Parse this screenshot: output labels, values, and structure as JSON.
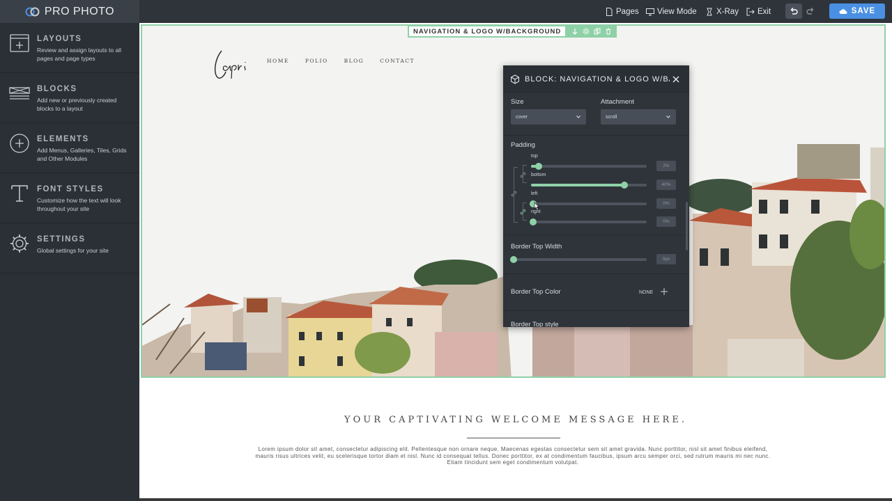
{
  "brand": {
    "name": "PRO PHOTO"
  },
  "topbar": {
    "pages": "Pages",
    "view_mode": "View Mode",
    "xray": "X-Ray",
    "exit": "Exit",
    "save": "SAVE",
    "accent": "#4a90e2"
  },
  "sidebar": {
    "items": [
      {
        "title": "LAYOUTS",
        "desc": "Review and assign layouts to all pages and page types",
        "icon": "layout-icon"
      },
      {
        "title": "BLOCKS",
        "desc": "Add new or previously created blocks to a layout",
        "icon": "blocks-icon"
      },
      {
        "title": "ELEMENTS",
        "desc": "Add Menus, Galleries, Tiles, Grids and Other Modules",
        "icon": "plus-circle-icon"
      },
      {
        "title": "FONT STYLES",
        "desc": "Customize how the text will look throughout your site",
        "icon": "font-icon"
      },
      {
        "title": "SETTINGS",
        "desc": "Global settings for your site",
        "icon": "gear-icon"
      }
    ]
  },
  "canvas": {
    "block_label": "NAVIGATION & LOGO W/BACKGROUND",
    "logo_text": "Capri",
    "nav": [
      "HOME",
      "POLIO",
      "BLOG",
      "CONTACT"
    ],
    "highlight_color": "#8fd1a7",
    "welcome": "YOUR CAPTIVATING WELCOME MESSAGE HERE.",
    "lorem": "Lorem ipsum dolor sit amet, consectetur adipiscing elit. Pellentesque non ornare neque. Maecenas egestas consectetur sem sit amet gravida. Nunc porttitor, nisl sit amet finibus eleifend, mauris risus ultrices velit, eu scelerisque tortor diam et nisl. Nunc id consequat tellus. Donec porttitor, ex at condimentum faucibus, ipsum arcu semper orci, sed rutrum mauris mi nec nunc. Etiam tincidunt sem eget condimentum volutpat."
  },
  "panel": {
    "title": "BLOCK: NAVIGATION & LOGO W/BACKGROUND",
    "size_label": "Size",
    "size_value": "cover",
    "attachment_label": "Attachment",
    "attachment_value": "scroll",
    "padding_label": "Padding",
    "padding": [
      {
        "label": "top",
        "value": "2%",
        "level": 0.05
      },
      {
        "label": "bottom",
        "value": "40%",
        "level": 0.79
      },
      {
        "label": "left",
        "value": "0%",
        "level": 0.0
      },
      {
        "label": "right",
        "value": "0%",
        "level": 0.0
      }
    ],
    "border_top_width_label": "Border Top Width",
    "border_top_width_value": "0px",
    "border_top_color_label": "Border Top Color",
    "border_top_color_value": "NONE",
    "border_top_style_label": "Border Top style"
  }
}
